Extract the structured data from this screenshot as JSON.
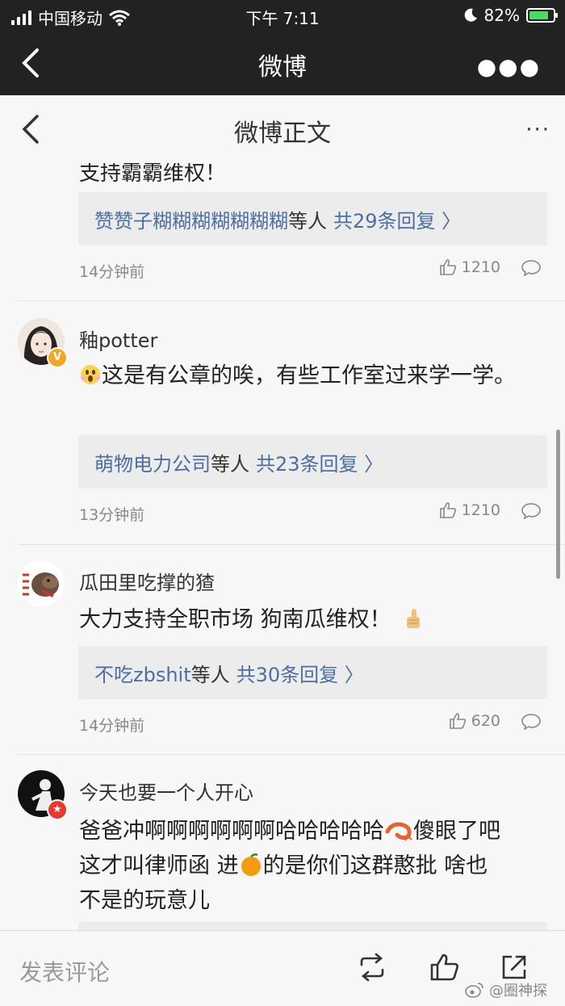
{
  "status_bar": {
    "carrier": "中国移动",
    "time": "下午 7:11",
    "battery": "82%",
    "battery_level": 0.82
  },
  "app_header": {
    "title": "微博"
  },
  "sub_header": {
    "title": "微博正文"
  },
  "partial_comment": {
    "text": "支持霸霸维权！",
    "reply_user": "赞赞子糊糊糊糊糊糊糊",
    "reply_etc": "等人",
    "reply_count": "共29条回复 〉",
    "time": "14分钟前",
    "likes": "1210"
  },
  "comments": [
    {
      "name": "釉potter",
      "text": "这是有公章的唉，有些工作室过来学一学。",
      "reply_user": "萌物电力公司",
      "reply_etc": "等人",
      "reply_count": "共23条回复 〉",
      "time": "13分钟前",
      "likes": "1210"
    },
    {
      "name": "瓜田里吃撑的猹",
      "text": "大力支持全职市场 狗南瓜维权！",
      "reply_user": "不吃zbshit",
      "reply_etc": "等人",
      "reply_count": "共30条回复 〉",
      "time": "14分钟前",
      "likes": "620"
    },
    {
      "name": "今天也要一个人开心",
      "text_line1": "爸爸冲啊啊啊啊啊啊哈哈哈哈哈",
      "text_line1b": "傻眼了吧",
      "text_line2a": "这才叫律师函 进",
      "text_line2b": "的是你们这群憨批 啥也",
      "text_line3": "不是的玩意儿"
    }
  ],
  "bottom_bar": {
    "post_placeholder": "发表评论",
    "watermark": "@圈神探"
  },
  "colors": {
    "link": "#4a6fa0",
    "header_bg": "#222222",
    "battery": "#4cd964",
    "verified": "#f5a623",
    "star_badge": "#e8382d"
  }
}
